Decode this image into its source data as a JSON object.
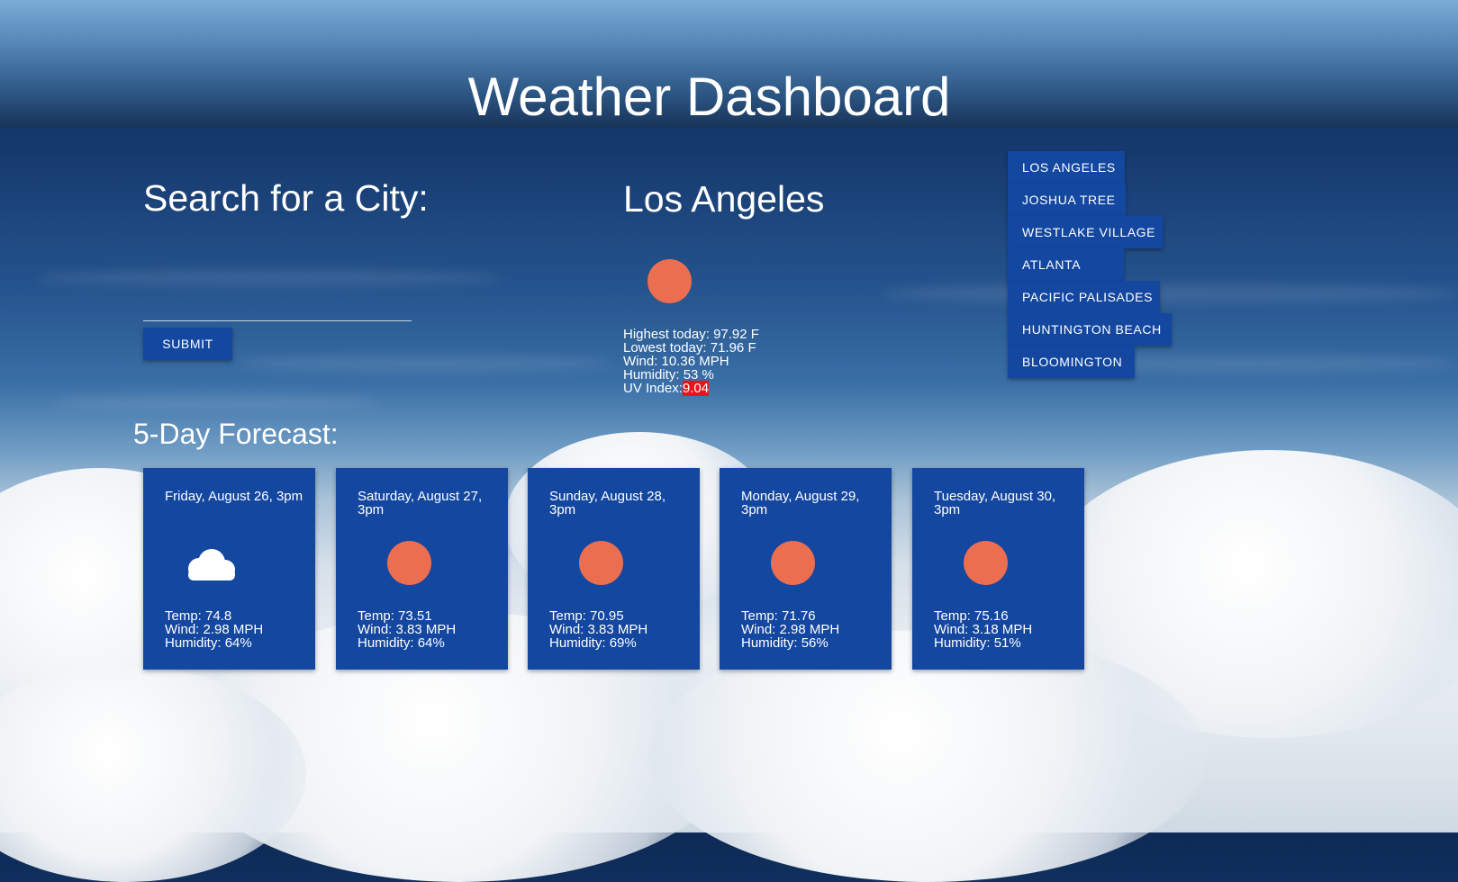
{
  "header": {
    "title": "Weather Dashboard"
  },
  "search": {
    "heading": "Search for a City:",
    "input_value": "",
    "placeholder": "",
    "submit_label": "Submit"
  },
  "current": {
    "city": "Los Angeles",
    "icon": "sun-icon",
    "highest_label": "Highest today:",
    "highest_value": "97.92 F",
    "lowest_label": "Lowest today:",
    "lowest_value": "71.96 F",
    "wind_label": "Wind:",
    "wind_value": "10.36 MPH",
    "humidity_label": "Humidity:",
    "humidity_value": "53 %",
    "uv_label": "UV Index:",
    "uv_value": "9.04",
    "uv_color": "#e8141d"
  },
  "history": {
    "items": [
      {
        "label": "Los Angeles"
      },
      {
        "label": "Joshua Tree"
      },
      {
        "label": "Westlake Village"
      },
      {
        "label": "Atlanta"
      },
      {
        "label": "Pacific Palisades"
      },
      {
        "label": "Huntington Beach"
      },
      {
        "label": "Bloomington"
      }
    ]
  },
  "forecast": {
    "heading": "5-Day Forecast:",
    "days": [
      {
        "date": "Friday, August 26, 3pm",
        "icon": "cloud-icon",
        "temp_label": "Temp:",
        "temp": "74.8",
        "wind_label": "Wind:",
        "wind": "2.98 MPH",
        "humidity_label": "Humidity:",
        "humidity": "64%"
      },
      {
        "date": "Saturday, August 27, 3pm",
        "icon": "sun-icon",
        "temp_label": "Temp:",
        "temp": "73.51",
        "wind_label": "Wind:",
        "wind": "3.83 MPH",
        "humidity_label": "Humidity:",
        "humidity": "64%"
      },
      {
        "date": "Sunday, August 28, 3pm",
        "icon": "sun-icon",
        "temp_label": "Temp:",
        "temp": "70.95",
        "wind_label": "Wind:",
        "wind": "3.83 MPH",
        "humidity_label": "Humidity:",
        "humidity": "69%"
      },
      {
        "date": "Monday, August 29, 3pm",
        "icon": "sun-icon",
        "temp_label": "Temp:",
        "temp": "71.76",
        "wind_label": "Wind:",
        "wind": "2.98 MPH",
        "humidity_label": "Humidity:",
        "humidity": "56%"
      },
      {
        "date": "Tuesday, August 30, 3pm",
        "icon": "sun-icon",
        "temp_label": "Temp:",
        "temp": "75.16",
        "wind_label": "Wind:",
        "wind": "3.18 MPH",
        "humidity_label": "Humidity:",
        "humidity": "51%"
      }
    ]
  },
  "colors": {
    "card_bg": "#1447a0",
    "button_bg": "#1447a0",
    "sun": "#eb6e50",
    "uv_high": "#e8141d"
  }
}
